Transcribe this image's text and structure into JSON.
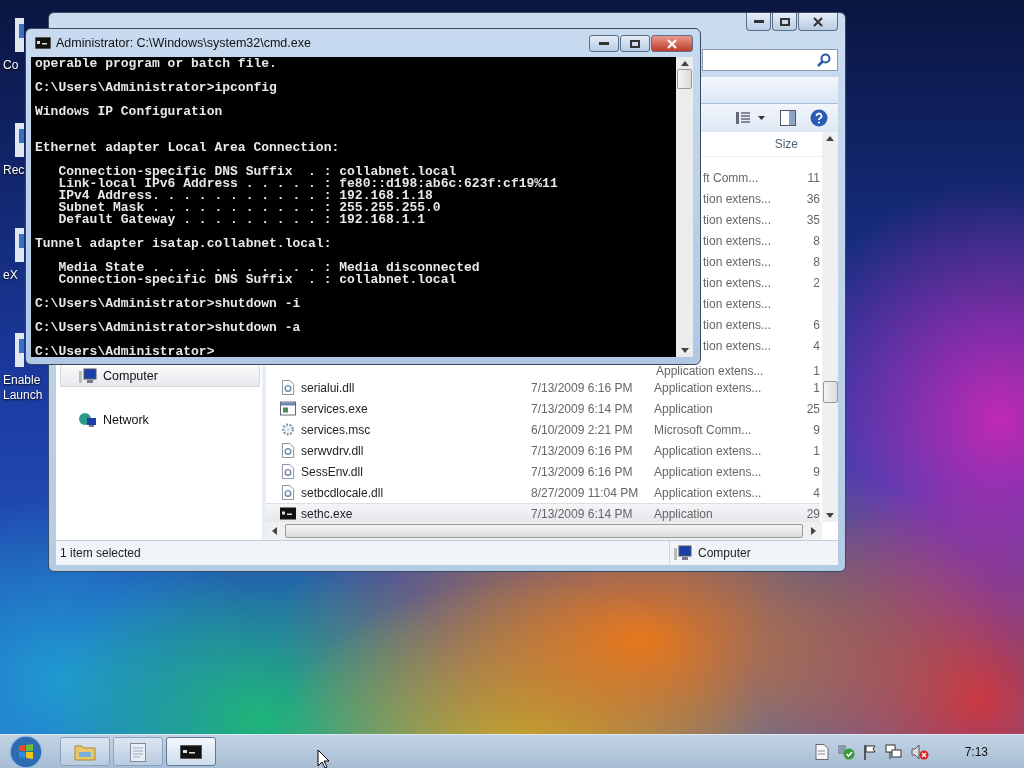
{
  "desktop": {
    "icons": [
      {
        "lines": [
          "Co"
        ]
      },
      {
        "lines": [
          "Rec"
        ]
      },
      {
        "lines": [
          "eX"
        ]
      },
      {
        "lines": [
          "Enable",
          "Launch"
        ]
      }
    ]
  },
  "explorer": {
    "columns": [
      {
        "label": "Size"
      }
    ],
    "sidebar": {
      "items": [
        {
          "label": "Computer",
          "selected": true
        },
        {
          "label": "Network",
          "selected": false
        }
      ]
    },
    "rows": [
      {
        "kind": "covered",
        "type": "ft Comm...",
        "size": "11",
        "selected": false
      },
      {
        "kind": "covered",
        "type": "tion extens...",
        "size": "36",
        "selected": false
      },
      {
        "kind": "covered",
        "type": "tion extens...",
        "size": "35",
        "selected": false
      },
      {
        "kind": "covered",
        "type": "tion extens...",
        "size": "8",
        "selected": false
      },
      {
        "kind": "covered",
        "type": "tion extens...",
        "size": "8",
        "selected": false
      },
      {
        "kind": "covered",
        "type": "tion extens...",
        "size": "2",
        "selected": false
      },
      {
        "kind": "covered",
        "type": "tion extens...",
        "selected": false
      },
      {
        "kind": "covered",
        "type": "tion extens...",
        "size": "6",
        "selected": false
      },
      {
        "kind": "covered",
        "type": "tion extens...",
        "size": "4",
        "selected": false
      },
      {
        "kind": "partial",
        "type": "Application extens...",
        "size": "1",
        "selected": false
      },
      {
        "kind": "dll",
        "name": "serialui.dll",
        "date": "7/13/2009 6:16 PM",
        "type": "Application extens...",
        "size": "1",
        "selected": false
      },
      {
        "kind": "exe",
        "name": "services.exe",
        "date": "7/13/2009 6:14 PM",
        "type": "Application",
        "size": "25",
        "selected": false
      },
      {
        "kind": "msc",
        "name": "services.msc",
        "date": "6/10/2009 2:21 PM",
        "type": "Microsoft Comm...",
        "size": "9",
        "selected": false
      },
      {
        "kind": "dll",
        "name": "serwvdrv.dll",
        "date": "7/13/2009 6:16 PM",
        "type": "Application extens...",
        "size": "1",
        "selected": false
      },
      {
        "kind": "dll",
        "name": "SessEnv.dll",
        "date": "7/13/2009 6:16 PM",
        "type": "Application extens...",
        "size": "9",
        "selected": false
      },
      {
        "kind": "dll",
        "name": "setbcdlocale.dll",
        "date": "8/27/2009 11:04 PM",
        "type": "Application extens...",
        "size": "4",
        "selected": false
      },
      {
        "kind": "console",
        "name": "sethc.exe",
        "date": "7/13/2009 6:14 PM",
        "type": "Application",
        "size": "29",
        "selected": true
      }
    ],
    "status": {
      "text": "1 item selected",
      "zone": "Computer"
    }
  },
  "cmd": {
    "title": "Administrator: C:\\Windows\\system32\\cmd.exe",
    "output": "operable program or batch file.\n\nC:\\Users\\Administrator>ipconfig\n\nWindows IP Configuration\n\n\nEthernet adapter Local Area Connection:\n\n   Connection-specific DNS Suffix  . : collabnet.local\n   Link-local IPv6 Address . . . . . : fe80::d198:ab6c:623f:cf19%11\n   IPv4 Address. . . . . . . . . . . : 192.168.1.18\n   Subnet Mask . . . . . . . . . . . : 255.255.255.0\n   Default Gateway . . . . . . . . . : 192.168.1.1\n\nTunnel adapter isatap.collabnet.local:\n\n   Media State . . . . . . . . . . . : Media disconnected\n   Connection-specific DNS Suffix  . : collabnet.local\n\nC:\\Users\\Administrator>shutdown -i\n\nC:\\Users\\Administrator>shutdown -a\n\nC:\\Users\\Administrator>"
  },
  "taskbar": {
    "buttons": [
      {
        "kind": "folder",
        "selected": false
      },
      {
        "kind": "notepad",
        "selected": false
      },
      {
        "kind": "console",
        "selected": true
      }
    ],
    "clock": "7:13"
  }
}
